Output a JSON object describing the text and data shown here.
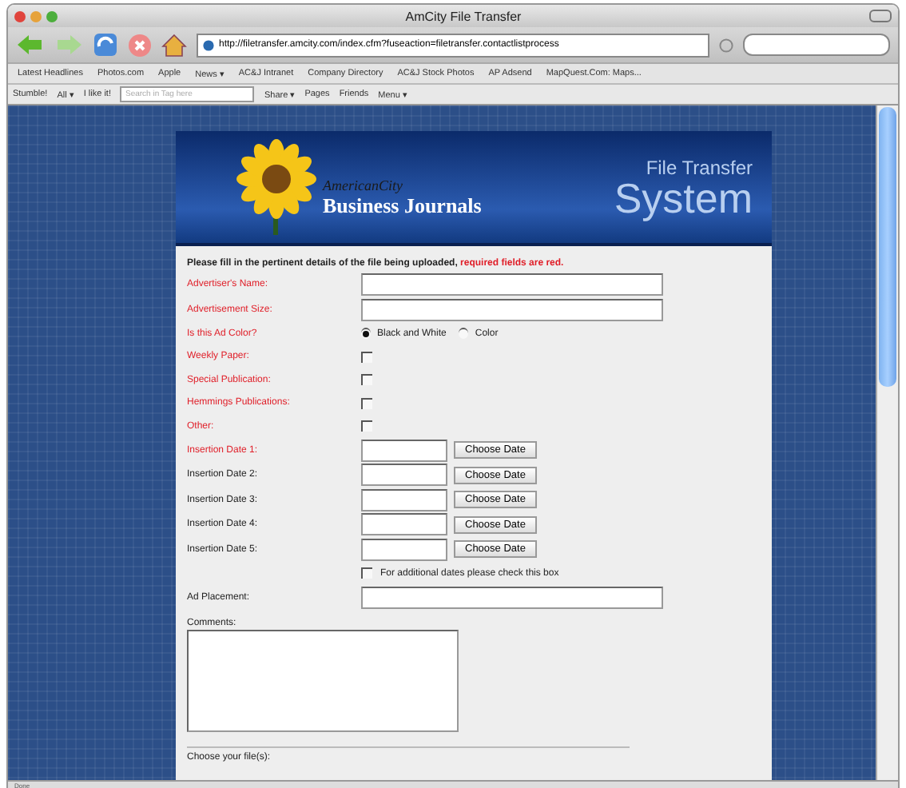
{
  "window": {
    "title": "AmCity File Transfer"
  },
  "toolbar": {
    "url": "http://filetransfer.amcity.com/index.cfm?fuseaction=filetransfer.contactlistprocess"
  },
  "bookmarks": [
    "Latest Headlines",
    "Photos.com",
    "Apple",
    "News ▾",
    "AC&J Intranet",
    "Company Directory",
    "AC&J Stock Photos",
    "AP Adsend",
    "MapQuest.Com: Maps..."
  ],
  "stumble_bar": {
    "items": [
      "Stumble!",
      "All ▾",
      "I like it!"
    ],
    "search_placeholder": "Search in Tag here",
    "tools": [
      "Share ▾",
      "Pages",
      "Friends",
      "Menu ▾"
    ]
  },
  "banner": {
    "logo_top": "AmericanCity",
    "logo_bottom": "Business Journals",
    "title_top": "File Transfer",
    "title_bottom": "System"
  },
  "form": {
    "intro": "Please fill in the pertinent details of the file being uploaded, ",
    "intro_required": "required fields are red.",
    "rows": [
      {
        "kind": "text",
        "label": "Advertiser's Name:",
        "required": true
      },
      {
        "kind": "text",
        "label": "Advertisement Size:",
        "required": true
      },
      {
        "kind": "radio",
        "label": "Is this Ad Color?",
        "required": true,
        "options": [
          {
            "label": "Black and White",
            "selected": true
          },
          {
            "label": "Color",
            "selected": false
          }
        ]
      },
      {
        "kind": "checkbox",
        "label": "Weekly Paper:",
        "required": true,
        "checked": false
      },
      {
        "kind": "checkbox",
        "label": "Special Publication:",
        "required": true,
        "checked": false
      },
      {
        "kind": "checkbox",
        "label": "Hemmings Publications:",
        "required": true,
        "checked": false
      },
      {
        "kind": "checkbox",
        "label": "Other:",
        "required": true,
        "checked": false
      },
      {
        "kind": "date",
        "label": "Insertion Date 1:",
        "required": true,
        "button": "Choose Date"
      },
      {
        "kind": "date",
        "label": "Insertion Date 2:",
        "required": false,
        "button": "Choose Date"
      },
      {
        "kind": "date",
        "label": "Insertion Date 3:",
        "required": false,
        "button": "Choose Date"
      },
      {
        "kind": "date",
        "label": "Insertion Date 4:",
        "required": false,
        "button": "Choose Date"
      },
      {
        "kind": "date",
        "label": "Insertion Date 5:",
        "required": false,
        "button": "Choose Date"
      },
      {
        "kind": "note_checkbox",
        "label": "For additional dates please check this box",
        "checked": false
      },
      {
        "kind": "text",
        "label": "Ad Placement:",
        "required": false
      }
    ],
    "comments_label": "Comments:",
    "files_label": "Choose your file(s):"
  },
  "status_bar": "Done"
}
